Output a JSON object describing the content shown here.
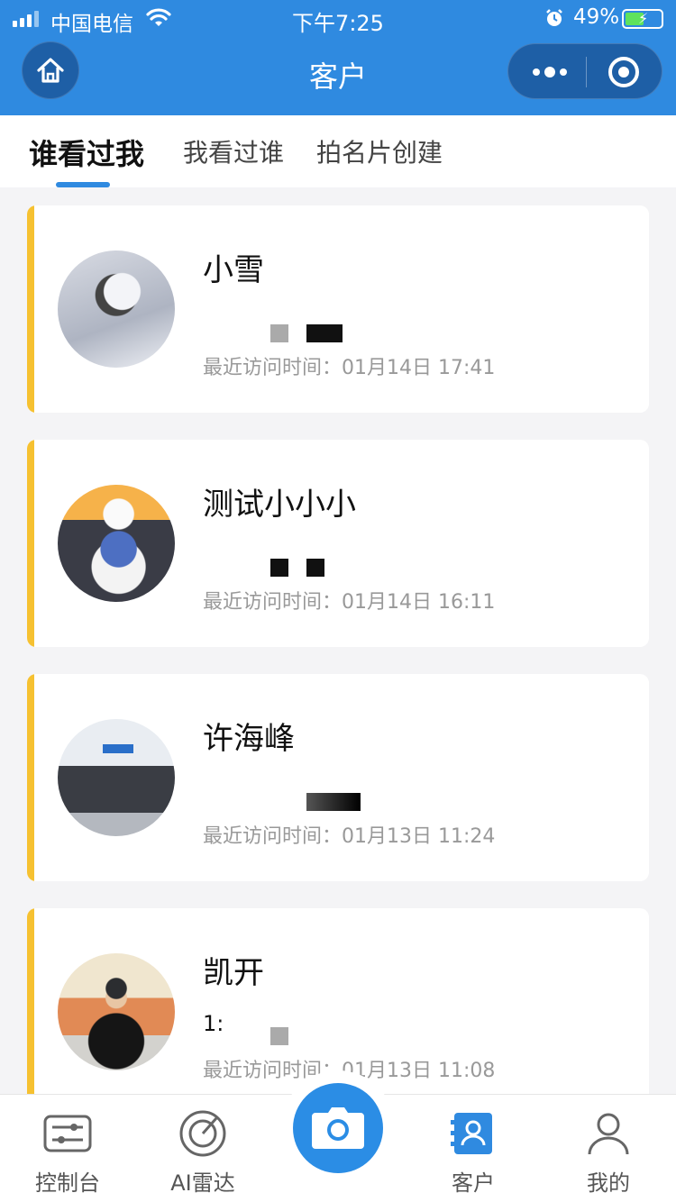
{
  "status_bar": {
    "carrier": "中国电信",
    "time": "下午7:25",
    "battery_percent": "49%"
  },
  "nav": {
    "title": "客户"
  },
  "tabs": [
    {
      "label": "谁看过我",
      "active": true
    },
    {
      "label": "我看过谁",
      "active": false
    },
    {
      "label": "拍名片创建",
      "active": false
    }
  ],
  "customers": [
    {
      "name": "小雪",
      "visit_text": "最近访问时间：01月14日 17:41"
    },
    {
      "name": "测试小小小",
      "visit_text": "最近访问时间：01月14日 16:11"
    },
    {
      "name": "许海峰",
      "visit_text": "最近访问时间：01月13日 11:24"
    },
    {
      "name": "凯开",
      "partial_text": "1:",
      "visit_text": "最近访问时间：01月13日 11:08"
    }
  ],
  "tabbar": [
    {
      "label": "控制台",
      "icon": "console-icon",
      "active": false
    },
    {
      "label": "AI雷达",
      "icon": "radar-icon",
      "active": false
    },
    {
      "label": "",
      "icon": "camera-icon",
      "active": false
    },
    {
      "label": "客户",
      "icon": "contacts-icon",
      "active": true
    },
    {
      "label": "我的",
      "icon": "person-icon",
      "active": false
    }
  ],
  "colors": {
    "primary": "#2f8ae0",
    "accent_bar": "#f6c131",
    "muted_text": "#999999"
  }
}
